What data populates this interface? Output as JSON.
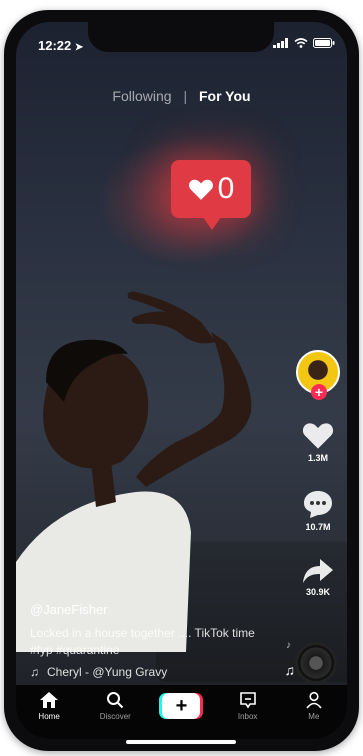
{
  "status_bar": {
    "time": "12:22"
  },
  "feed_tabs": {
    "following": "Following",
    "separator": "|",
    "for_you": "For You"
  },
  "like_bubble": {
    "count": "0"
  },
  "right_rail": {
    "likes": "1.3M",
    "comments": "10.7M",
    "shares": "30.9K",
    "follow_plus": "+"
  },
  "caption": {
    "username": "@JaneFisher",
    "description": "Locked in a house together .... TikTok time #fyp #quarantine",
    "sound": "Cheryl - @Yung Gravy"
  },
  "bottom_nav": {
    "home": "Home",
    "discover": "Discover",
    "create": "+",
    "inbox": "Inbox",
    "me": "Me"
  },
  "colors": {
    "accent_red": "#fe2c55",
    "accent_cyan": "#25f4ee",
    "like_bubble": "#e03b44"
  }
}
